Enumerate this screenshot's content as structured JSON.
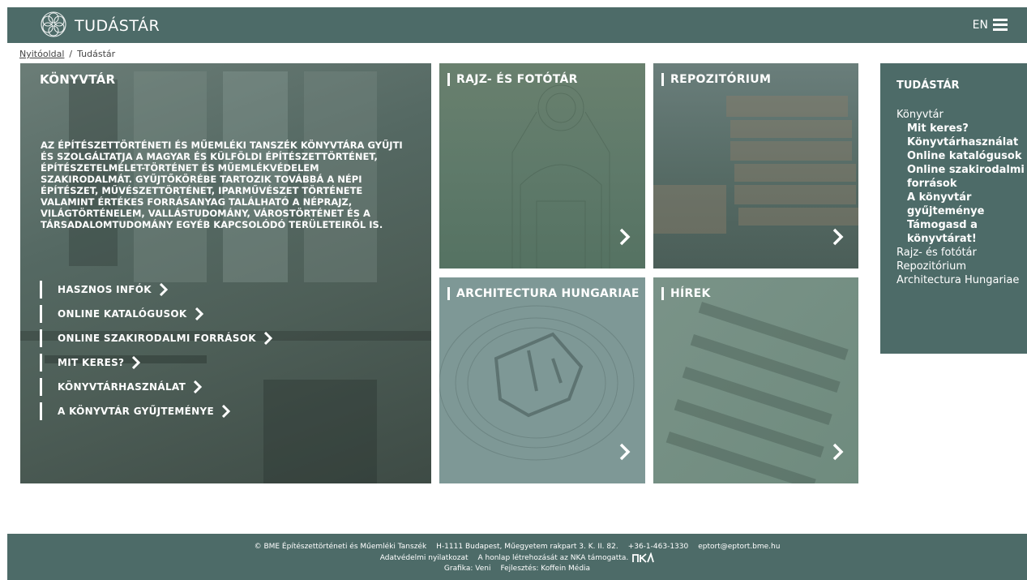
{
  "header": {
    "site_title": "TUDÁSTÁR",
    "lang": "EN"
  },
  "breadcrumb": {
    "home": "Nyitóoldal",
    "separator": "/",
    "current": "Tudástár"
  },
  "library": {
    "title": "KÖNYVTÁR",
    "description": "AZ ÉPÍTÉSZETTÖRTÉNETI ÉS MŰEMLÉKI TANSZÉK KÖNYVTÁRA GYŰJTI ÉS SZOLGÁLTATJA A MAGYAR ÉS KÜLFÖLDI ÉPÍTÉSZETTÖRTÉNET, ÉPÍTÉSZETELMÉLET-TÖRTÉNET ÉS MŰEMLÉKVÉDELEM SZAKIRODALMÁT. GYŰJTŐKÖRÉBE TARTOZIK TOVÁBBÁ A NÉPI ÉPÍTÉSZET, MŰVÉSZETTÖRTÉNET, IPARMŰVÉSZET TÖRTÉNETE VALAMINT ÉRTÉKES FORRÁSANYAG TALÁLHATÓ A NÉPRAJZ, VILÁGTÖRTÉNELEM, VALLÁSTUDOMÁNY, VÁROSTÖRTÉNET ÉS A TÁRSADALOMTUDOMÁNY EGYÉB KAPCSOLÓDÓ TERÜLETEIRŐL IS.",
    "links": [
      "HASZNOS INFÓK",
      "ONLINE KATALÓGUSOK",
      "ONLINE SZAKIRODALMI FORRÁSOK",
      "MIT KERES?",
      "KÖNYVTÁRHASZNÁLAT",
      "A KÖNYVTÁR GYŰJTEMÉNYE"
    ]
  },
  "tiles": {
    "rajz": "RAJZ- ÉS FOTÓTÁR",
    "repo": "REPOZITÓRIUM",
    "arch": "ARCHITECTURA HUNGARIAE",
    "hirek": "HÍREK"
  },
  "sidebar": {
    "heading": "TUDÁSTÁR",
    "section": "Könyvtár",
    "subitems": [
      "Mit keres?",
      "Könyvtárhasználat",
      "Online katalógusok",
      "Online szakirodalmi források",
      "A könyvtár gyűjteménye",
      "Támogasd a könyvtárat!"
    ],
    "items": [
      "Rajz- és fotótár",
      "Repozitórium",
      "Architectura Hungariae"
    ]
  },
  "footer": {
    "copyright": "© BME Építészettörténeti és Műemléki Tanszék",
    "address": "H-1111 Budapest, Műegyetem rakpart 3. K. II. 82.",
    "phone": "+36-1-463-1330",
    "email": "eptort@eptort.bme.hu",
    "privacy": "Adatvédelmi nyilatkozat",
    "support": "A honlap létrehozását az NKA támogatta.",
    "graphics": "Grafika: Veni",
    "dev": "Fejlesztés: Koffein Média"
  },
  "colors": {
    "brand": "#4d6b68"
  },
  "icons": {
    "logo": "flower-logo-icon",
    "menu": "hamburger-menu-icon",
    "arrow": "chevron-right-icon"
  }
}
